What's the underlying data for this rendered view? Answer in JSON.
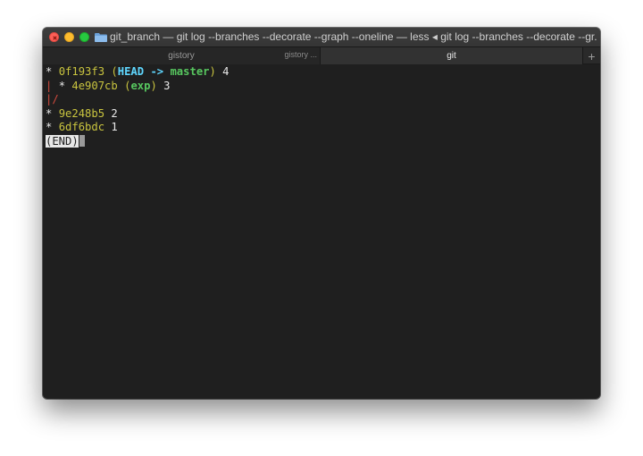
{
  "window": {
    "title": "git_branch — git log --branches --decorate --graph --oneline — less ◂ git log --branches --decorate --gr..."
  },
  "tabs": [
    {
      "label": "gistory",
      "sub": "gistory ...",
      "active": false
    },
    {
      "label": "git",
      "active": true
    }
  ],
  "new_tab_label": "+",
  "terminal": {
    "lines": [
      {
        "star": "* ",
        "hash": "0f193f3",
        "open": " (",
        "head": "HEAD",
        "arrow": " -> ",
        "branch": "master",
        "close": ")",
        "msg": " 4"
      },
      {
        "graph": "| ",
        "star": "* ",
        "hash": "4e907cb",
        "open": " (",
        "branch": "exp",
        "close": ")",
        "msg": " 3"
      },
      {
        "graph": "|/"
      },
      {
        "star": "* ",
        "hash": "9e248b5",
        "msg": " 2"
      },
      {
        "star": "* ",
        "hash": "6df6bdc",
        "msg": " 1"
      }
    ],
    "prompt": "(END)"
  },
  "colors": {
    "hash": "#c9c43f",
    "head": "#5fd7ff",
    "branch": "#57c75f",
    "graph": "#d24a3e"
  }
}
